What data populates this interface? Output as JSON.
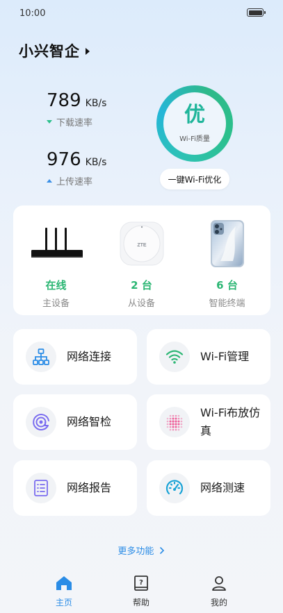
{
  "status": {
    "time": "10:00"
  },
  "header": {
    "title": "小兴智企"
  },
  "speeds": {
    "download": {
      "value": "789",
      "unit": "KB/s",
      "label": "下载速率"
    },
    "upload": {
      "value": "976",
      "unit": "KB/s",
      "label": "上传速率"
    }
  },
  "quality": {
    "grade": "优",
    "label": "Wi-Fi质量",
    "button": "一键Wi-Fi优化"
  },
  "devices": {
    "main": {
      "status": "在线",
      "label": "主设备"
    },
    "sub": {
      "status": "2 台",
      "label": "从设备"
    },
    "terminal": {
      "status": "6 台",
      "label": "智能终端"
    },
    "sub_brand": "ZTE"
  },
  "features": [
    {
      "label": "网络连接",
      "icon": "network-topology-icon"
    },
    {
      "label": "Wi-Fi管理",
      "icon": "wifi-icon"
    },
    {
      "label": "网络智检",
      "icon": "scan-icon"
    },
    {
      "label": "Wi-Fi布放仿真",
      "icon": "heatmap-dots-icon"
    },
    {
      "label": "网络报告",
      "icon": "report-icon"
    },
    {
      "label": "网络测速",
      "icon": "speedometer-icon"
    }
  ],
  "more": "更多功能",
  "tabs": [
    {
      "label": "主页",
      "active": true
    },
    {
      "label": "帮助",
      "active": false
    },
    {
      "label": "我的",
      "active": false
    }
  ],
  "colors": {
    "accent": "#2a8ce6",
    "online": "#2bb673",
    "quality": "#1fb59a"
  }
}
